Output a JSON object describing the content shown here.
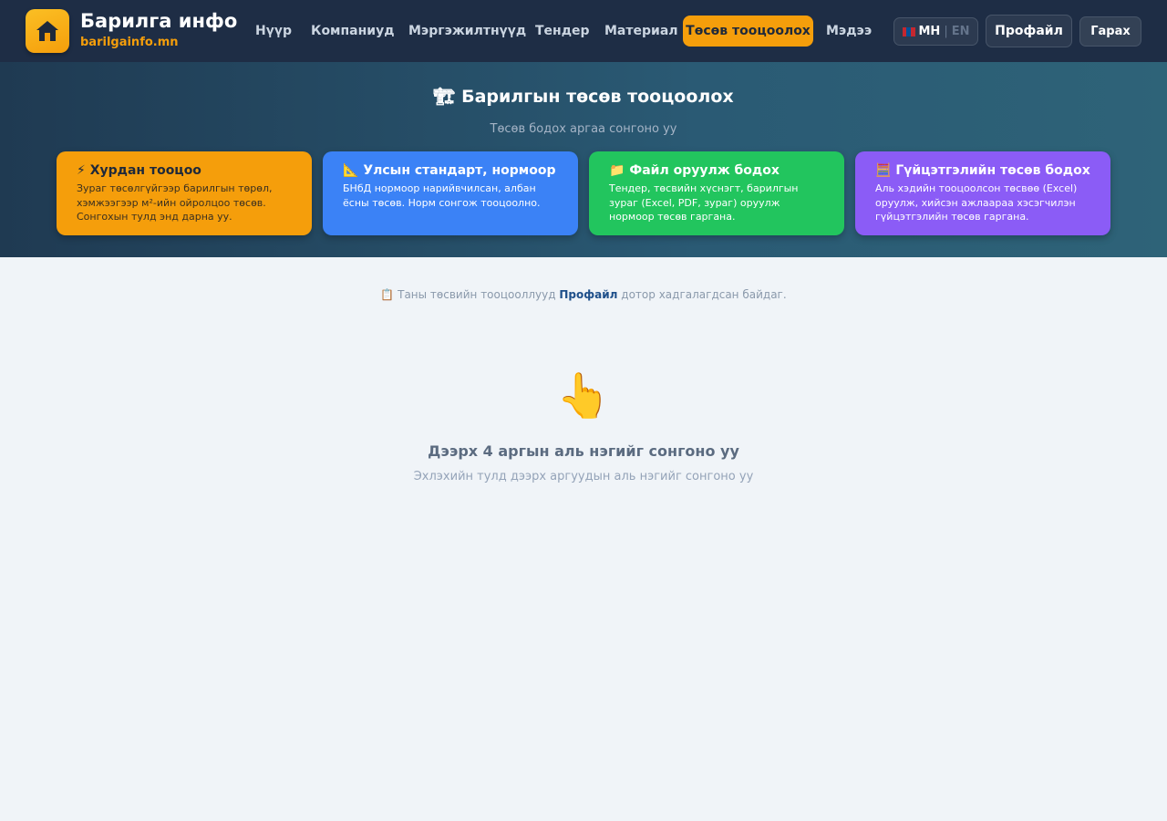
{
  "header": {
    "brand_title": "Барилга инфо",
    "brand_sub": "barilgainfo.mn",
    "nav": [
      "Нүүр",
      "Компаниуд",
      "Мэргэжилтнүүд",
      "Тендер",
      "Материал",
      "Төсөв тооцоолох",
      "Мэдээ"
    ],
    "active_nav": "Төсөв тооцоолох",
    "lang_mn": "МН",
    "lang_sep": "|",
    "lang_en": "EN",
    "profile_label": "Профайл",
    "exit_label": "Гарах"
  },
  "hero": {
    "icon": "🏗",
    "title": "Барилгын төсөв тооцоолох",
    "subtitle": "Төсөв бодох аргаа сонгоно уу",
    "cards": [
      {
        "icon": "⚡",
        "title": "Хурдан тооцоо",
        "desc": "Зураг төсөлгүйгээр барилгын төрөл, хэмжээгээр м²-ийн ойролцоо төсөв. Сонгохын тулд энд дарна уу."
      },
      {
        "icon": "📐",
        "title": "Улсын стандарт, нормоор",
        "desc": "БНбД нормоор нарийвчилсан, албан ёсны төсөв. Норм сонгож тооцоолно."
      },
      {
        "icon": "📁",
        "title": "Файл оруулж бодох",
        "desc": "Тендер, төсвийн хүснэгт, барилгын зураг (Excel, PDF, зураг) оруулж нормоор төсөв гаргана."
      },
      {
        "icon": "🧮",
        "title": "Гүйцэтгэлийн төсөв бодох",
        "desc": "Аль хэдийн тооцоолсон төсвөө (Excel) оруулж, хийсэн ажлаараа хэсэгчилэн гүйцэтгэлийн төсөв гаргана."
      }
    ]
  },
  "main": {
    "note_icon": "📋",
    "note_before": "Таны төсвийн тооцооллууд",
    "note_link": "Профайл",
    "note_after": "дотор хадгалагдсан байдаг.",
    "pointer_icon": "👆",
    "empty_title": "Дээрх 4 аргын аль нэгийг сонгоно уу",
    "empty_sub": "Эхлэхийн тулд дээрх аргуудын аль нэгийг сонгоно уу"
  },
  "colors": {
    "accent": "#f59e0b",
    "nav_bg": "#1e2d45",
    "card_orange": "#f59e0b",
    "card_blue": "#3b82f6",
    "card_green": "#22c55e",
    "card_purple": "#8b5cf6"
  }
}
